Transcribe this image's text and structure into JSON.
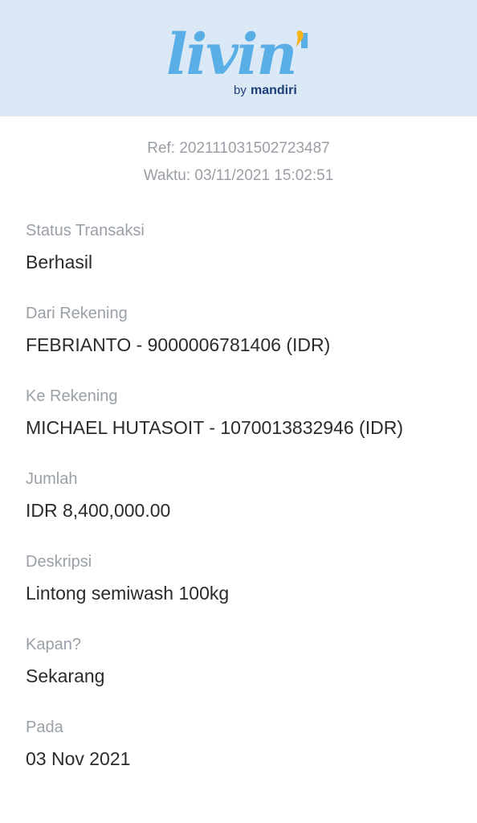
{
  "header": {
    "logo_text": "livin'",
    "logo_byline_prefix": "by",
    "logo_byline_brand": "mandiri",
    "colors": {
      "background": "#dbe8f5",
      "logo_blue": "#5aaee6",
      "apostrophe_yellow": "#f5b41c",
      "brand_navy": "#1c3f7a"
    }
  },
  "reference": {
    "ref": "Ref: 202111031502723487",
    "time": "Waktu: 03/11/2021 15:02:51"
  },
  "fields": [
    {
      "label": "Status Transaksi",
      "value": "Berhasil"
    },
    {
      "label": "Dari Rekening",
      "value": "FEBRIANTO - 9000006781406 (IDR)"
    },
    {
      "label": "Ke Rekening",
      "value": "MICHAEL HUTASOIT - 1070013832946 (IDR)"
    },
    {
      "label": "Jumlah",
      "value": "IDR 8,400,000.00"
    },
    {
      "label": "Deskripsi",
      "value": "Lintong semiwash 100kg"
    },
    {
      "label": "Kapan?",
      "value": "Sekarang"
    },
    {
      "label": "Pada",
      "value": "03 Nov 2021"
    }
  ]
}
